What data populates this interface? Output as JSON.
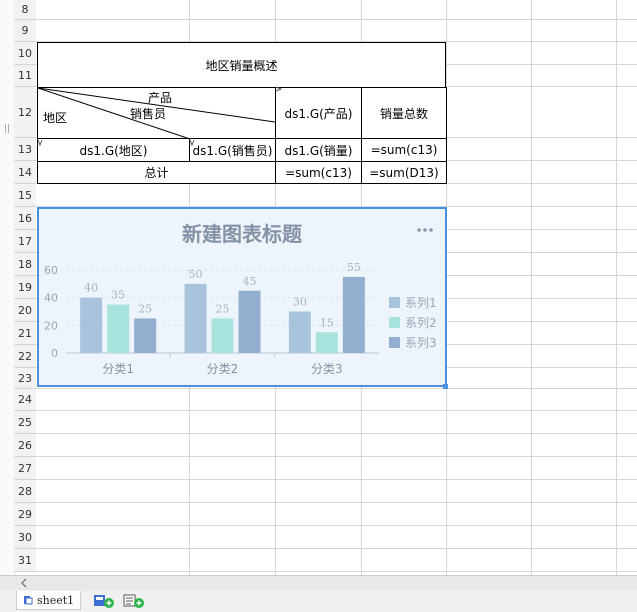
{
  "rows": [
    "8",
    "9",
    "10",
    "11",
    "12",
    "13",
    "14",
    "15",
    "16",
    "17",
    "18",
    "19",
    "20",
    "21",
    "22",
    "23",
    "24",
    "25",
    "26",
    "27",
    "28",
    "29",
    "30",
    "31"
  ],
  "report": {
    "title": "地区销量概述",
    "diag_product": "产品",
    "diag_salesman": "销售员",
    "diag_region": "地区",
    "header_product": "ds1.G(产品)",
    "header_total": "销量总数",
    "r13_region": "ds1.G(地区)",
    "r13_salesman": "ds1.G(销售员)",
    "r13_sales": "ds1.G(销量)",
    "r13_sum": "=sum(c13)",
    "r14_total_label": "总计",
    "r14_sum_c": "=sum(c13)",
    "r14_sum_d": "=sum(D13)"
  },
  "chart_data": {
    "type": "bar",
    "title": "新建图表标题",
    "categories": [
      "分类1",
      "分类2",
      "分类3"
    ],
    "series": [
      {
        "name": "系列1",
        "values": [
          40,
          50,
          30
        ],
        "color": "#a9c3dc"
      },
      {
        "name": "系列2",
        "values": [
          35,
          25,
          15
        ],
        "color": "#a8e2dc"
      },
      {
        "name": "系列3",
        "values": [
          25,
          45,
          55
        ],
        "color": "#93afcf"
      }
    ],
    "y_ticks": [
      "60",
      "40",
      "20",
      "0"
    ],
    "ylim": [
      0,
      60
    ],
    "legend": "right",
    "grid": true
  },
  "chart_menu_icon": "more-dots-icon",
  "sheet_tab": {
    "label": "sheet1",
    "icon": "sheet-icon"
  },
  "toolbar_icons": [
    "add-sheet-icon",
    "add-report-icon"
  ],
  "scroll_left_icon": "chevron-left-icon"
}
